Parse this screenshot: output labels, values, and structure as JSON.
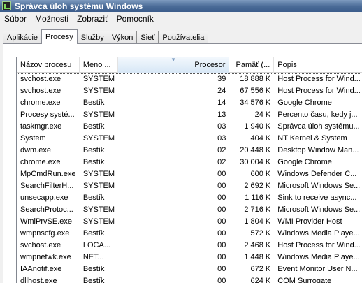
{
  "window": {
    "title": "Správca úloh systému Windows"
  },
  "menu": [
    "Súbor",
    "Možnosti",
    "Zobraziť",
    "Pomocník"
  ],
  "tabs": [
    {
      "label": "Aplikácie",
      "active": false
    },
    {
      "label": "Procesy",
      "active": true
    },
    {
      "label": "Služby",
      "active": false
    },
    {
      "label": "Výkon",
      "active": false
    },
    {
      "label": "Sieť",
      "active": false
    },
    {
      "label": "Používatelia",
      "active": false
    }
  ],
  "columns": {
    "name": "Názov procesu",
    "user": "Meno ...",
    "cpu": "Procesor",
    "mem": "Pamäť (...",
    "desc": "Popis",
    "sorted_column": "cpu"
  },
  "processes": [
    {
      "name": "svchost.exe",
      "user": "SYSTEM",
      "cpu": "39",
      "mem": "18 888 K",
      "desc": "Host Process for Wind...",
      "selected": true
    },
    {
      "name": "svchost.exe",
      "user": "SYSTEM",
      "cpu": "24",
      "mem": "67 556 K",
      "desc": "Host Process for Wind..."
    },
    {
      "name": "chrome.exe",
      "user": "Bestík",
      "cpu": "14",
      "mem": "34 576 K",
      "desc": "Google Chrome"
    },
    {
      "name": "Procesy systé...",
      "user": "SYSTEM",
      "cpu": "13",
      "mem": "24 K",
      "desc": "Percento času, kedy j..."
    },
    {
      "name": "taskmgr.exe",
      "user": "Bestík",
      "cpu": "03",
      "mem": "1 940 K",
      "desc": "Správca úloh systému..."
    },
    {
      "name": "System",
      "user": "SYSTEM",
      "cpu": "03",
      "mem": "404 K",
      "desc": "NT Kernel & System"
    },
    {
      "name": "dwm.exe",
      "user": "Bestík",
      "cpu": "02",
      "mem": "20 448 K",
      "desc": "Desktop Window Man..."
    },
    {
      "name": "chrome.exe",
      "user": "Bestík",
      "cpu": "02",
      "mem": "30 004 K",
      "desc": "Google Chrome"
    },
    {
      "name": "MpCmdRun.exe",
      "user": "SYSTEM",
      "cpu": "00",
      "mem": "600 K",
      "desc": "Windows Defender C..."
    },
    {
      "name": "SearchFilterH...",
      "user": "SYSTEM",
      "cpu": "00",
      "mem": "2 692 K",
      "desc": "Microsoft Windows Se..."
    },
    {
      "name": "unsecapp.exe",
      "user": "Bestík",
      "cpu": "00",
      "mem": "1 116 K",
      "desc": "Sink to receive async..."
    },
    {
      "name": "SearchProtoc...",
      "user": "SYSTEM",
      "cpu": "00",
      "mem": "2 716 K",
      "desc": "Microsoft Windows Se..."
    },
    {
      "name": "WmiPrvSE.exe",
      "user": "SYSTEM",
      "cpu": "00",
      "mem": "1 804 K",
      "desc": "WMI Provider Host"
    },
    {
      "name": "wmpnscfg.exe",
      "user": "Bestík",
      "cpu": "00",
      "mem": "572 K",
      "desc": "Windows Media Playe..."
    },
    {
      "name": "svchost.exe",
      "user": "LOCA...",
      "cpu": "00",
      "mem": "2 468 K",
      "desc": "Host Process for Wind..."
    },
    {
      "name": "wmpnetwk.exe",
      "user": "NET...",
      "cpu": "00",
      "mem": "1 448 K",
      "desc": "Windows Media Playe..."
    },
    {
      "name": "IAAnotif.exe",
      "user": "Bestík",
      "cpu": "00",
      "mem": "672 K",
      "desc": "Event Monitor User N..."
    },
    {
      "name": "dllhost.exe",
      "user": "Bestík",
      "cpu": "00",
      "mem": "624 K",
      "desc": "COM Surrogate"
    }
  ]
}
